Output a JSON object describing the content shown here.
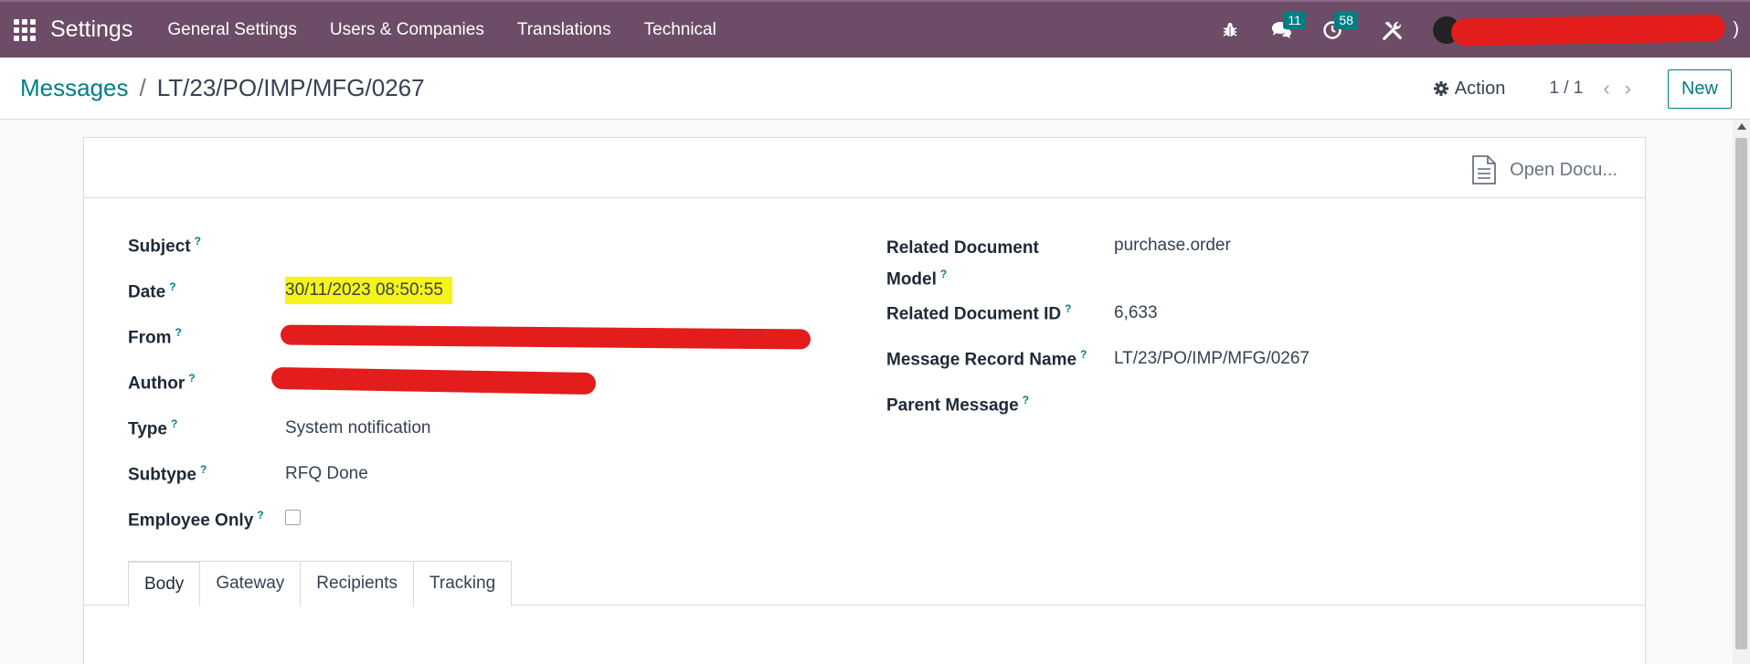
{
  "topbar": {
    "app_name": "Settings",
    "menu": [
      "General Settings",
      "Users & Companies",
      "Translations",
      "Technical"
    ],
    "chat_count": "11",
    "activity_count": "58",
    "user_suffix": ")"
  },
  "breadcrumb": {
    "parent": "Messages",
    "separator": "/",
    "current": "LT/23/PO/IMP/MFG/0267"
  },
  "control": {
    "action_label": "Action",
    "pager": "1 / 1",
    "new_label": "New"
  },
  "sheet": {
    "open_document_label": "Open Docu..."
  },
  "fields_left": {
    "subject": {
      "label": "Subject",
      "value": ""
    },
    "date": {
      "label": "Date",
      "value": "30/11/2023 08:50:55"
    },
    "from": {
      "label": "From",
      "value": ""
    },
    "author": {
      "label": "Author",
      "value": ""
    },
    "type": {
      "label": "Type",
      "value": "System notification"
    },
    "subtype": {
      "label": "Subtype",
      "value": "RFQ Done"
    },
    "employee_only": {
      "label": "Employee Only",
      "checked": false
    }
  },
  "fields_right": {
    "related_model": {
      "label_line1": "Related Document",
      "label_line2": "Model",
      "value": "purchase.order"
    },
    "related_id": {
      "label": "Related Document ID",
      "value": "6,633"
    },
    "record_name": {
      "label": "Message Record Name",
      "value": "LT/23/PO/IMP/MFG/0267"
    },
    "parent_message": {
      "label": "Parent Message",
      "value": ""
    }
  },
  "tabs": [
    "Body",
    "Gateway",
    "Recipients",
    "Tracking"
  ],
  "help_marker": "?",
  "colors": {
    "navbar": "#6c4c66",
    "accent": "#017e84",
    "highlight": "#f6f31a",
    "redaction": "#e31c1c"
  }
}
